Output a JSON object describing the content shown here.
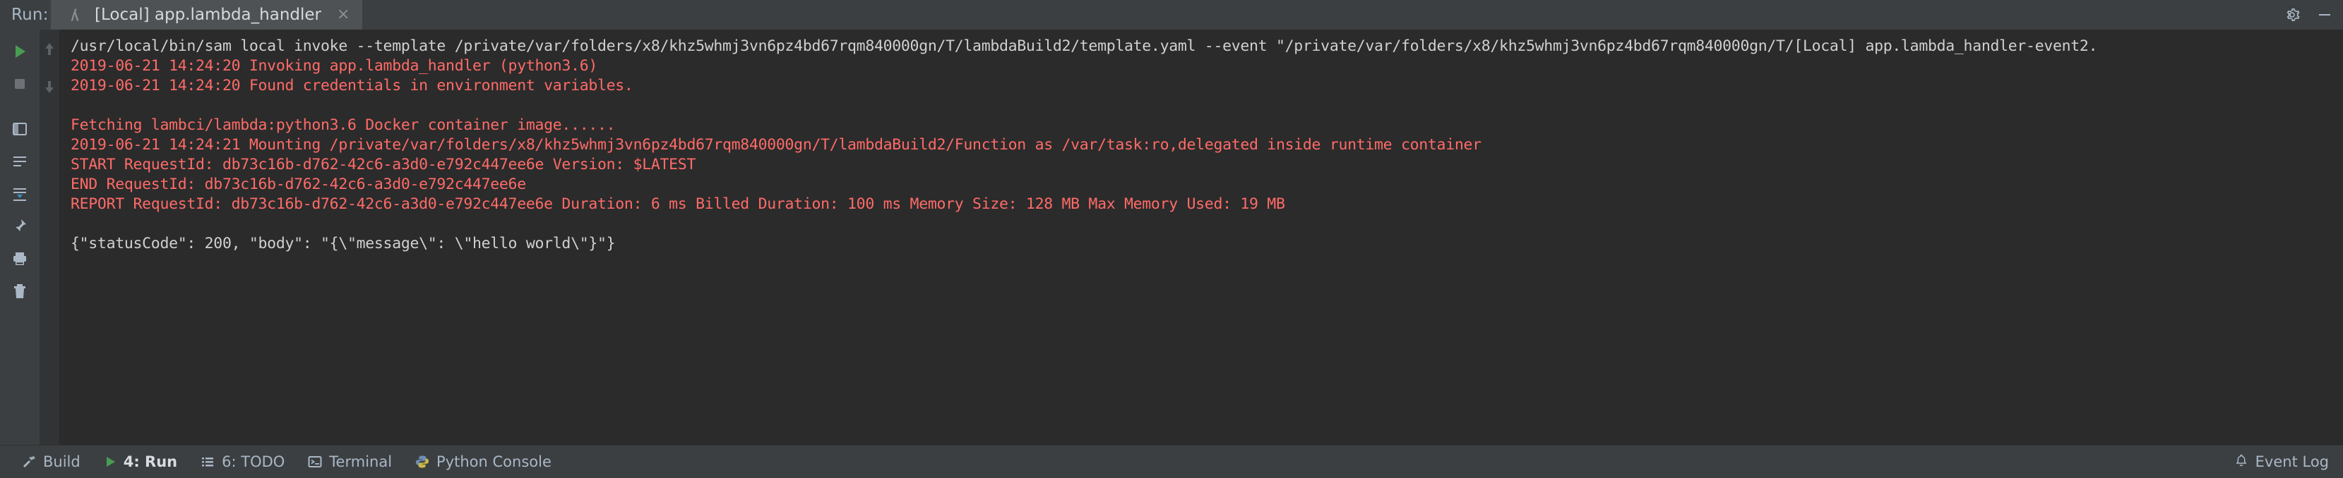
{
  "window": {
    "run_label": "Run:",
    "settings_icon": "gear-icon",
    "minimize_icon": "minimize-icon"
  },
  "tab": {
    "icon": "aws-lambda-icon",
    "title": "[Local] app.lambda_handler",
    "close": "×"
  },
  "left_toolbar": {
    "items": [
      {
        "name": "rerun-button",
        "icon": "play-icon"
      },
      {
        "name": "stop-button",
        "icon": "stop-square-icon"
      },
      {
        "name": "layout-button",
        "icon": "layout-icon"
      },
      {
        "name": "wrap-text-button",
        "icon": "wrap-text-icon"
      },
      {
        "name": "pin-tab-button",
        "icon": "pin-icon"
      },
      {
        "name": "print-button",
        "icon": "printer-icon"
      },
      {
        "name": "delete-button",
        "icon": "trash-icon"
      },
      {
        "name": "scroll-up-button",
        "icon": "arrow-up-icon"
      },
      {
        "name": "scroll-down-button",
        "icon": "arrow-down-icon"
      },
      {
        "name": "soft-wrap-button",
        "icon": "soft-wrap-icon"
      },
      {
        "name": "scroll-to-end-button",
        "icon": "scroll-end-icon"
      }
    ]
  },
  "console": {
    "lines": [
      {
        "text": "/usr/local/bin/sam local invoke --template /private/var/folders/x8/khz5whmj3vn6pz4bd67rqm840000gn/T/lambdaBuild2/template.yaml --event \"/private/var/folders/x8/khz5whmj3vn6pz4bd67rqm840000gn/T/[Local] app.lambda_handler-event2.",
        "style": "white"
      },
      {
        "text": "2019-06-21 14:24:20 Invoking app.lambda_handler (python3.6)",
        "style": "err"
      },
      {
        "text": "2019-06-21 14:24:20 Found credentials in environment variables.",
        "style": "err"
      },
      {
        "text": "",
        "style": "blank"
      },
      {
        "text": "Fetching lambci/lambda:python3.6 Docker container image......",
        "style": "err"
      },
      {
        "text": "2019-06-21 14:24:21 Mounting /private/var/folders/x8/khz5whmj3vn6pz4bd67rqm840000gn/T/lambdaBuild2/Function as /var/task:ro,delegated inside runtime container",
        "style": "err"
      },
      {
        "text": "START RequestId: db73c16b-d762-42c6-a3d0-e792c447ee6e Version: $LATEST",
        "style": "err"
      },
      {
        "text": "END RequestId: db73c16b-d762-42c6-a3d0-e792c447ee6e",
        "style": "err"
      },
      {
        "text": "REPORT RequestId: db73c16b-d762-42c6-a3d0-e792c447ee6e Duration: 6 ms Billed Duration: 100 ms Memory Size: 128 MB Max Memory Used: 19 MB",
        "style": "err"
      },
      {
        "text": "",
        "style": "blank"
      },
      {
        "text": "{\"statusCode\": 200, \"body\": \"{\\\"message\\\": \\\"hello world\\\"}\"}",
        "style": "white"
      }
    ]
  },
  "statusbar": {
    "items": [
      {
        "name": "status-build",
        "label": "Build",
        "icon": "hammer-icon",
        "active": false
      },
      {
        "name": "status-run",
        "label": "4: Run",
        "icon": "play-icon",
        "active": true
      },
      {
        "name": "status-todo",
        "label": "6: TODO",
        "icon": "list-icon",
        "active": false
      },
      {
        "name": "status-terminal",
        "label": "Terminal",
        "icon": "terminal-icon",
        "active": false
      },
      {
        "name": "status-python-console",
        "label": "Python Console",
        "icon": "python-icon",
        "active": false
      }
    ],
    "event_log": {
      "label": "Event Log",
      "icon": "bell-icon"
    }
  },
  "colors": {
    "background": "#3c3f41",
    "console_bg": "#2b2b2b",
    "error_text": "#ff6b68",
    "normal_text": "#d0d0d0",
    "tab_active": "#4e5254",
    "accent_green": "#499c54"
  }
}
